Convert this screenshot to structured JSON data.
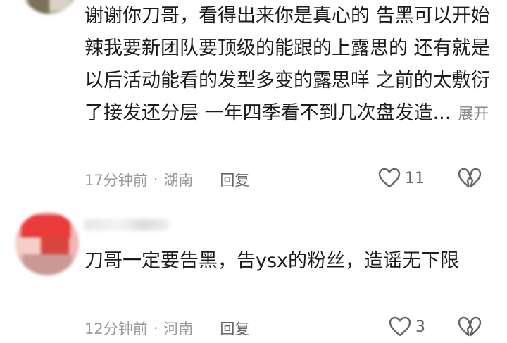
{
  "comments": [
    {
      "text": "谢谢你刀哥，看得出来你是真心的 告黑可以开始辣我要新团队要顶级的能跟的上露思的 还有就是以后活动能看的发型多变的露思咩 之前的太敷衍了接发还分层 一年四季看不到几次盘发造...",
      "expand_label": "展开",
      "time": "17分钟前",
      "location": "湖南",
      "reply_label": "回复",
      "like_count": "11"
    },
    {
      "text": "刀哥一定要告黑，告ysx的粉丝，造谣无下限",
      "time": "12分钟前",
      "location": "河南",
      "reply_label": "回复",
      "like_count": "3"
    }
  ],
  "separator": "·",
  "colors": {
    "text": "#1b1b1b",
    "meta": "#9a9a9a",
    "icon": "#666666"
  },
  "icons": {
    "like": "heart-outline",
    "dislike": "broken-heart-outline"
  }
}
